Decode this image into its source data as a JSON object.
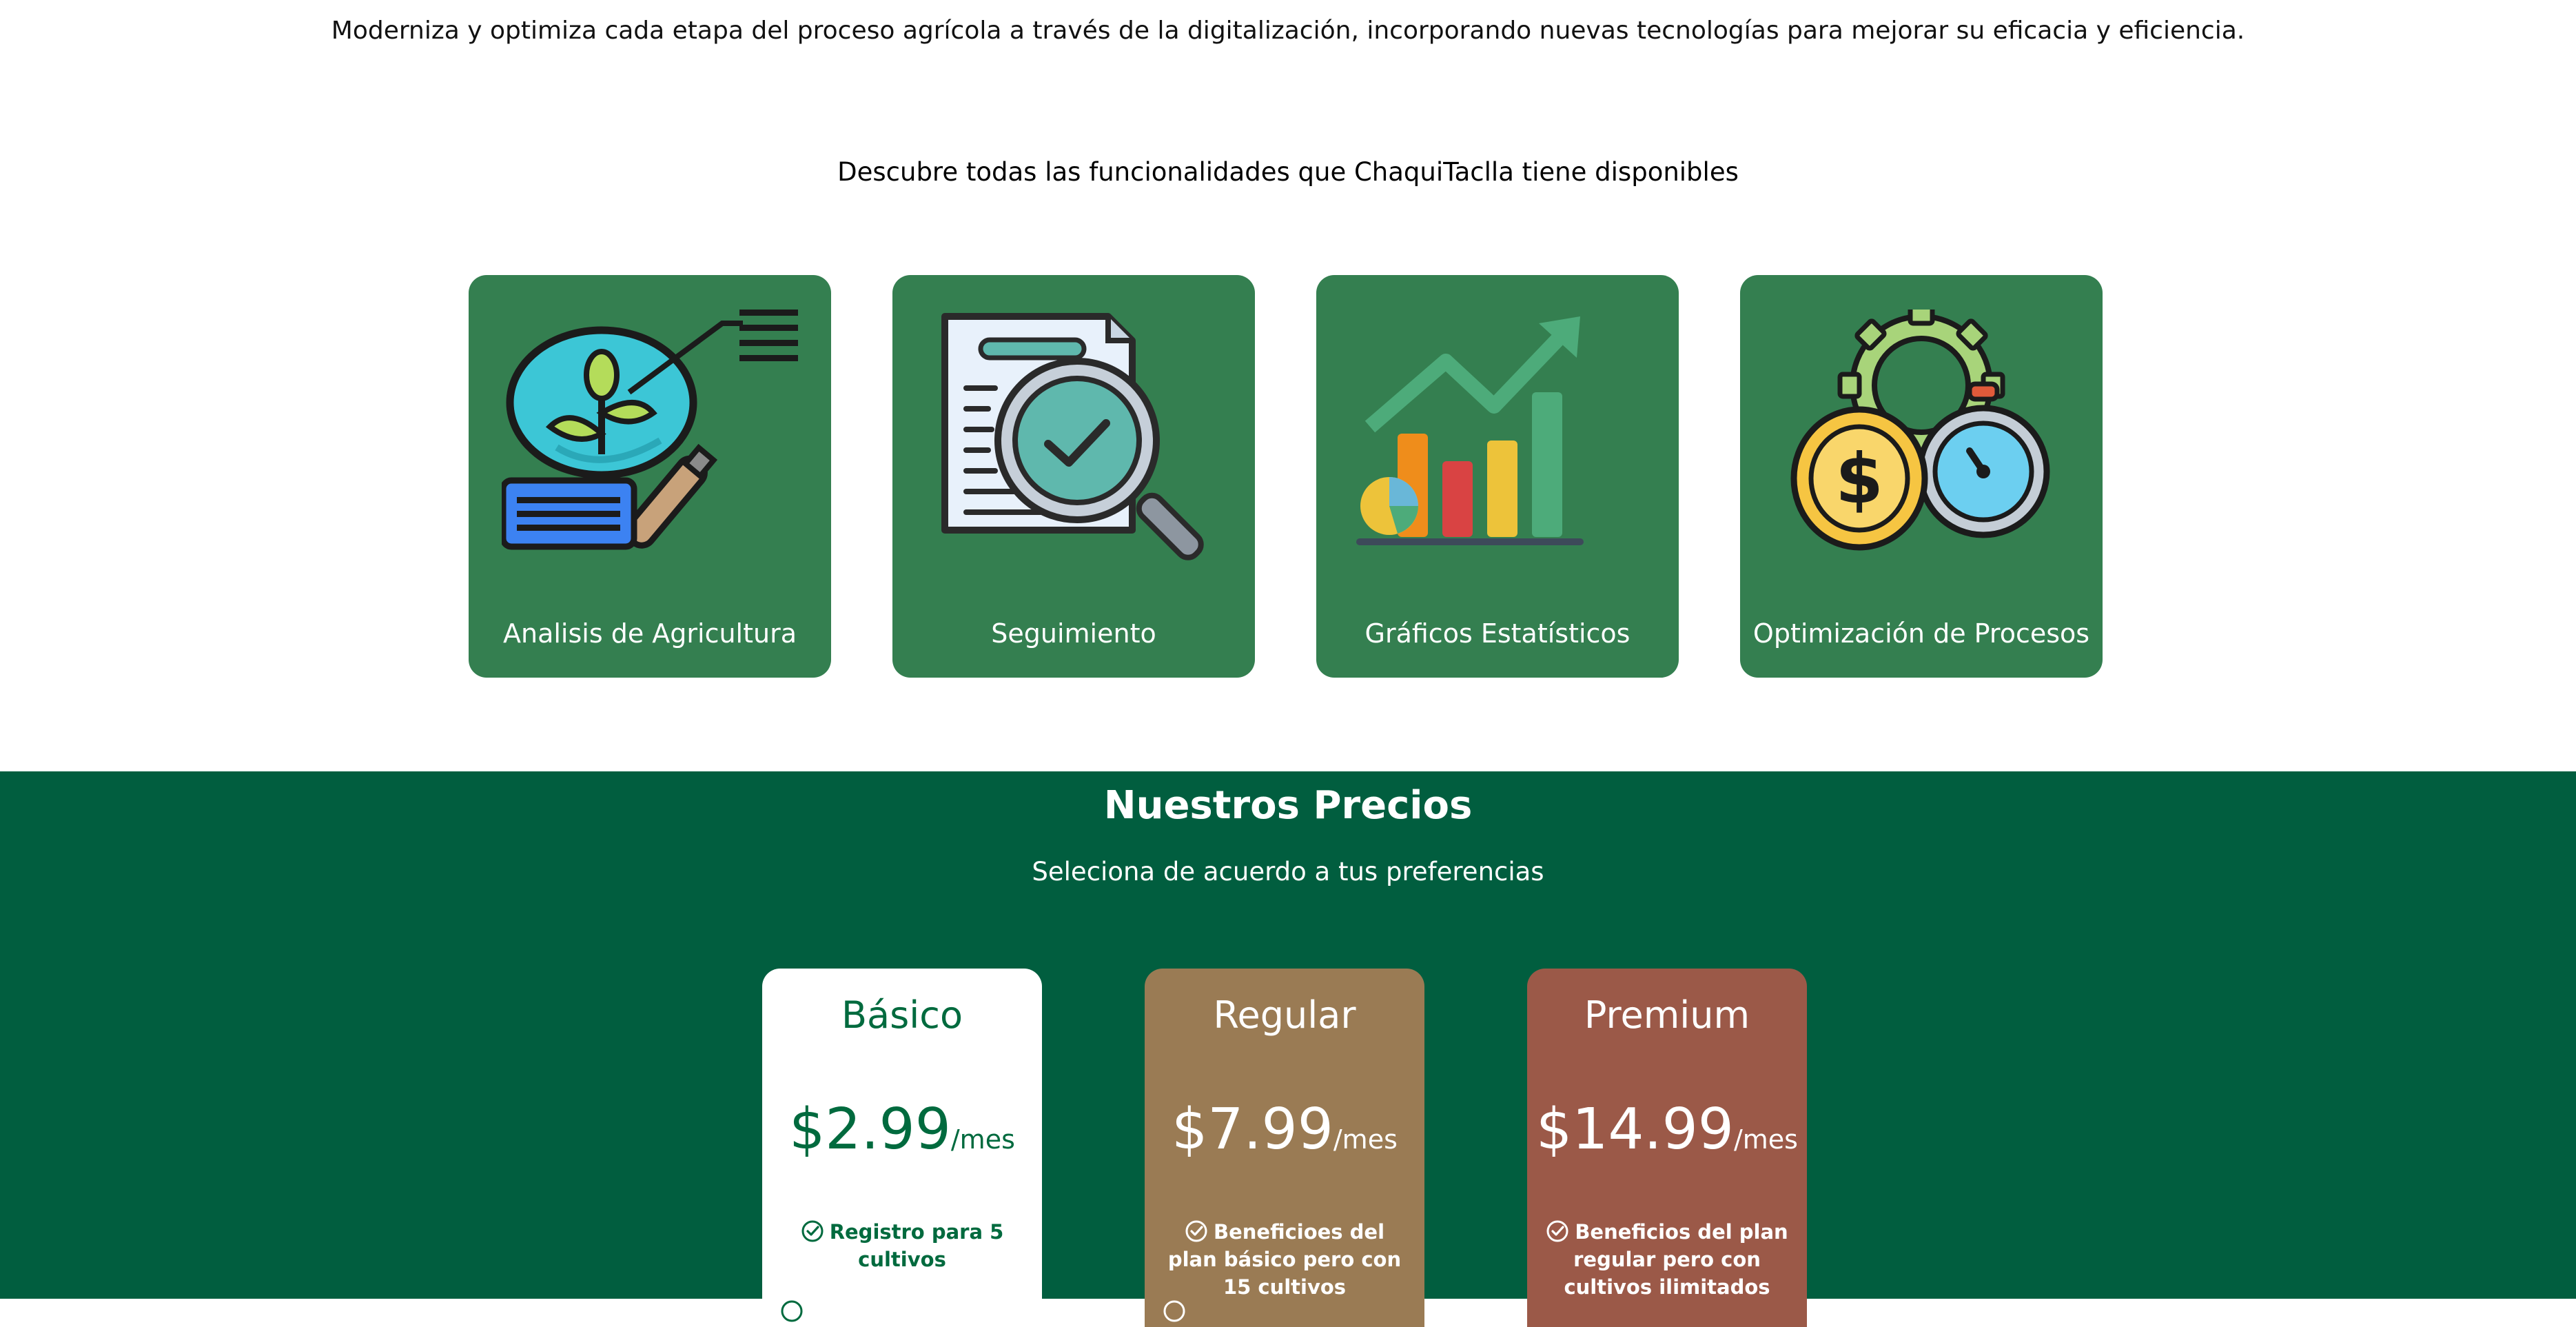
{
  "intro": {
    "tagline": "Moderniza y optimiza cada etapa del proceso agrícola a través de la digitalización, incorporando nuevas tecnologías para mejorar su eficacia y eficiencia.",
    "features_heading": "Descubre todas las funcionalidades que ChaquiTaclla tiene disponibles"
  },
  "features": [
    {
      "label": "Analisis de Agricultura",
      "icon": "plant-analysis-icon"
    },
    {
      "label": "Seguimiento",
      "icon": "document-search-icon"
    },
    {
      "label": "Gráficos Estatísticos",
      "icon": "bar-chart-growth-icon"
    },
    {
      "label": "Optimización de Procesos",
      "icon": "money-time-gear-icon"
    }
  ],
  "colors": {
    "feature_card": "#347f50",
    "pricing_bg": "#015e3f",
    "plan_basic": "#ffffff",
    "plan_regular": "#9a7b54",
    "plan_premium": "#9b5948"
  },
  "pricing": {
    "title": "Nuestros Precios",
    "subtitle": "Seleciona de acuerdo a tus preferencias",
    "plans": [
      {
        "name": "Básico",
        "price": "$2.99",
        "unit": "/mes",
        "feature": "Registro para 5 cultivos"
      },
      {
        "name": "Regular",
        "price": "$7.99",
        "unit": "/mes",
        "feature": "Beneficioes del plan básico pero con 15 cultivos"
      },
      {
        "name": "Premium",
        "price": "$14.99",
        "unit": "/mes",
        "feature": "Beneficios del plan regular pero con cultivos ilimitados"
      }
    ]
  }
}
